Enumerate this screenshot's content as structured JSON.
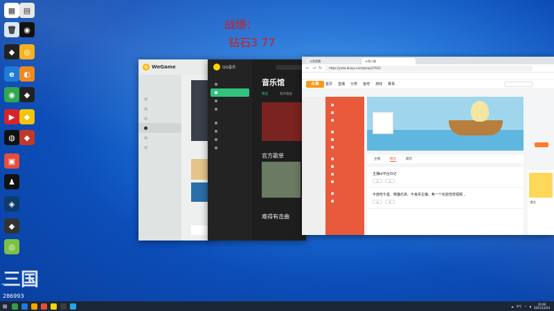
{
  "overlay": {
    "line1": "战绩：",
    "line2": "钻石3 77"
  },
  "desktop": {
    "icons": [
      {
        "label": "",
        "color": "#ffffff",
        "glyph": "▦",
        "icon": "settings-icon"
      },
      {
        "label": "",
        "color": "#e8e8e8",
        "glyph": "▤",
        "icon": "document-icon"
      },
      {
        "label": "",
        "color": "#d9e8f7",
        "glyph": "🗑",
        "icon": "recycle-bin-icon"
      },
      {
        "label": "",
        "color": "#111111",
        "glyph": "◉",
        "icon": "app-icon"
      },
      {
        "label": "",
        "color": "#222222",
        "glyph": "◆",
        "icon": "game-icon"
      },
      {
        "label": "",
        "color": "#f4b21e",
        "glyph": "◎",
        "icon": "app-icon"
      },
      {
        "label": "",
        "color": "#1f7ad8",
        "glyph": "e",
        "icon": "edge-icon"
      },
      {
        "label": "",
        "color": "#f08a1c",
        "glyph": "◐",
        "icon": "app-icon"
      },
      {
        "label": "",
        "color": "#2fa84f",
        "glyph": "◉",
        "icon": "chrome-icon"
      },
      {
        "label": "",
        "color": "#222222",
        "glyph": "◆",
        "icon": "game-icon"
      },
      {
        "label": "",
        "color": "#d8232a",
        "glyph": "▶",
        "icon": "video-icon"
      },
      {
        "label": "",
        "color": "#f1c40f",
        "glyph": "◆",
        "icon": "game-icon"
      },
      {
        "label": "",
        "color": "#111111",
        "glyph": "◍",
        "icon": "app-icon"
      },
      {
        "label": "",
        "color": "#c0392b",
        "glyph": "◆",
        "icon": "game-icon"
      },
      {
        "label": "",
        "color": "#e74c3c",
        "glyph": "▣",
        "icon": "app-icon"
      },
      {
        "label": "",
        "color": "#111111",
        "glyph": "♟",
        "icon": "qq-icon"
      },
      {
        "label": "",
        "color": "#0f3b6b",
        "glyph": "◈",
        "icon": "app-icon"
      },
      {
        "label": "",
        "color": "#333333",
        "glyph": "◆",
        "icon": "game-icon"
      },
      {
        "label": "",
        "color": "#7bc043",
        "glyph": "◎",
        "icon": "app-icon"
      }
    ]
  },
  "wegame": {
    "title": "WeGame",
    "items": [
      "",
      "",
      "",
      "",
      "",
      ""
    ],
    "active_index": 3
  },
  "qq": {
    "title": "QQ音乐",
    "heading": "音乐馆",
    "tabs": [
      "精选",
      "有声电台"
    ],
    "banner_text": "",
    "section": "官方歌单",
    "section2": "难得有击曲",
    "album_text": "",
    "album_caption": ""
  },
  "browser": {
    "tabs": [
      "斗鱼直播",
      "斗鱼小屋"
    ],
    "url": "https://yuba.douyu.com/group/27022",
    "site_logo": "斗鱼",
    "site_nav": [
      "首页",
      "直播",
      "分类",
      "鱼吧",
      "游戏",
      "赛事"
    ],
    "room_name": "",
    "follow_label": "",
    "room_tabs": [
      "主播",
      "精华",
      "最新"
    ],
    "posts": [
      {
        "title": "主播id平台日记",
        "meta": "",
        "likes": "2",
        "comments": "4"
      },
      {
        "title": "不放吃午盒、熊猫乐高、不良吊主播、焦一个实验性样视频...",
        "meta": "",
        "likes": "0",
        "comments": "0"
      }
    ],
    "right_title": "",
    "right_sub": "群主"
  },
  "watermark": {
    "big": "三国",
    "badge": "",
    "room_number": "286993"
  },
  "taskbar": {
    "temp": "9°C",
    "time": "10:46",
    "date": "2021/12/24"
  }
}
